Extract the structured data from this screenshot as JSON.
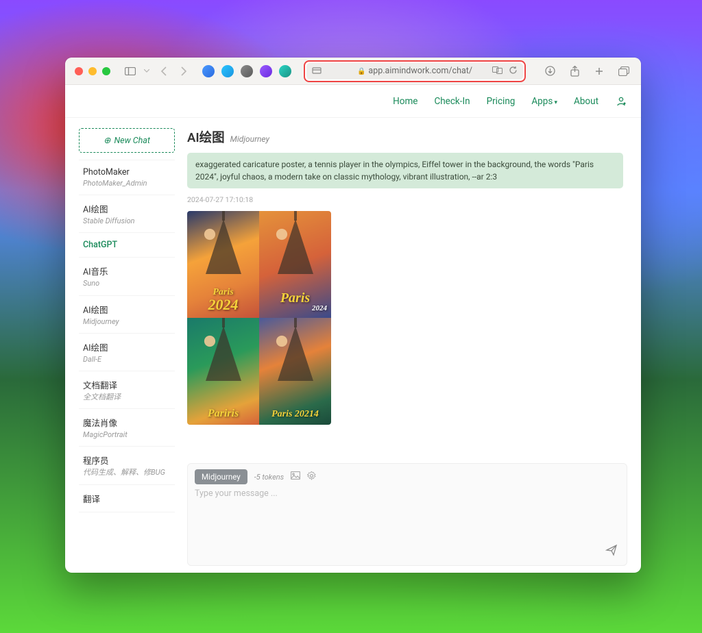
{
  "browser": {
    "url_display": "app.aimindwork.com/chat/"
  },
  "nav": {
    "home": "Home",
    "checkin": "Check-In",
    "pricing": "Pricing",
    "apps": "Apps",
    "about": "About"
  },
  "sidebar": {
    "new_chat": "New Chat",
    "items": [
      {
        "title": "PhotoMaker",
        "sub": "PhotoMaker_Admin"
      },
      {
        "title": "AI绘图",
        "sub": "Stable Diffusion"
      },
      {
        "title": "ChatGPT",
        "sub": ""
      },
      {
        "title": "AI音乐",
        "sub": "Suno"
      },
      {
        "title": "AI绘图",
        "sub": "Midjourney"
      },
      {
        "title": "AI绘图",
        "sub": "Dall-E"
      },
      {
        "title": "文档翻译",
        "sub": "全文档翻译"
      },
      {
        "title": "魔法肖像",
        "sub": "MagicPortrait"
      },
      {
        "title": "程序员",
        "sub": "代码生成、解释、修BUG"
      },
      {
        "title": "翻译",
        "sub": ""
      }
    ]
  },
  "main": {
    "title": "AI绘图",
    "subtitle": "Midjourney",
    "prompt": "exaggerated caricature poster, a tennis player in the olympics, Eiffel tower in the background, the words \"Paris 2024\", joyful chaos, a modern take on classic mythology, vibrant illustration, --ar 2:3",
    "timestamp": "2024-07-27 17:10:18",
    "tiles": {
      "tl_l1": "Paris",
      "tl_l2": "2024",
      "tr_l1": "Paris",
      "tr_l2": "2024",
      "bl_l1": "Pariris",
      "br_l1": "Paris 20214"
    }
  },
  "composer": {
    "model": "Midjourney",
    "tokens": "-5 tokens",
    "placeholder": "Type your message ..."
  }
}
